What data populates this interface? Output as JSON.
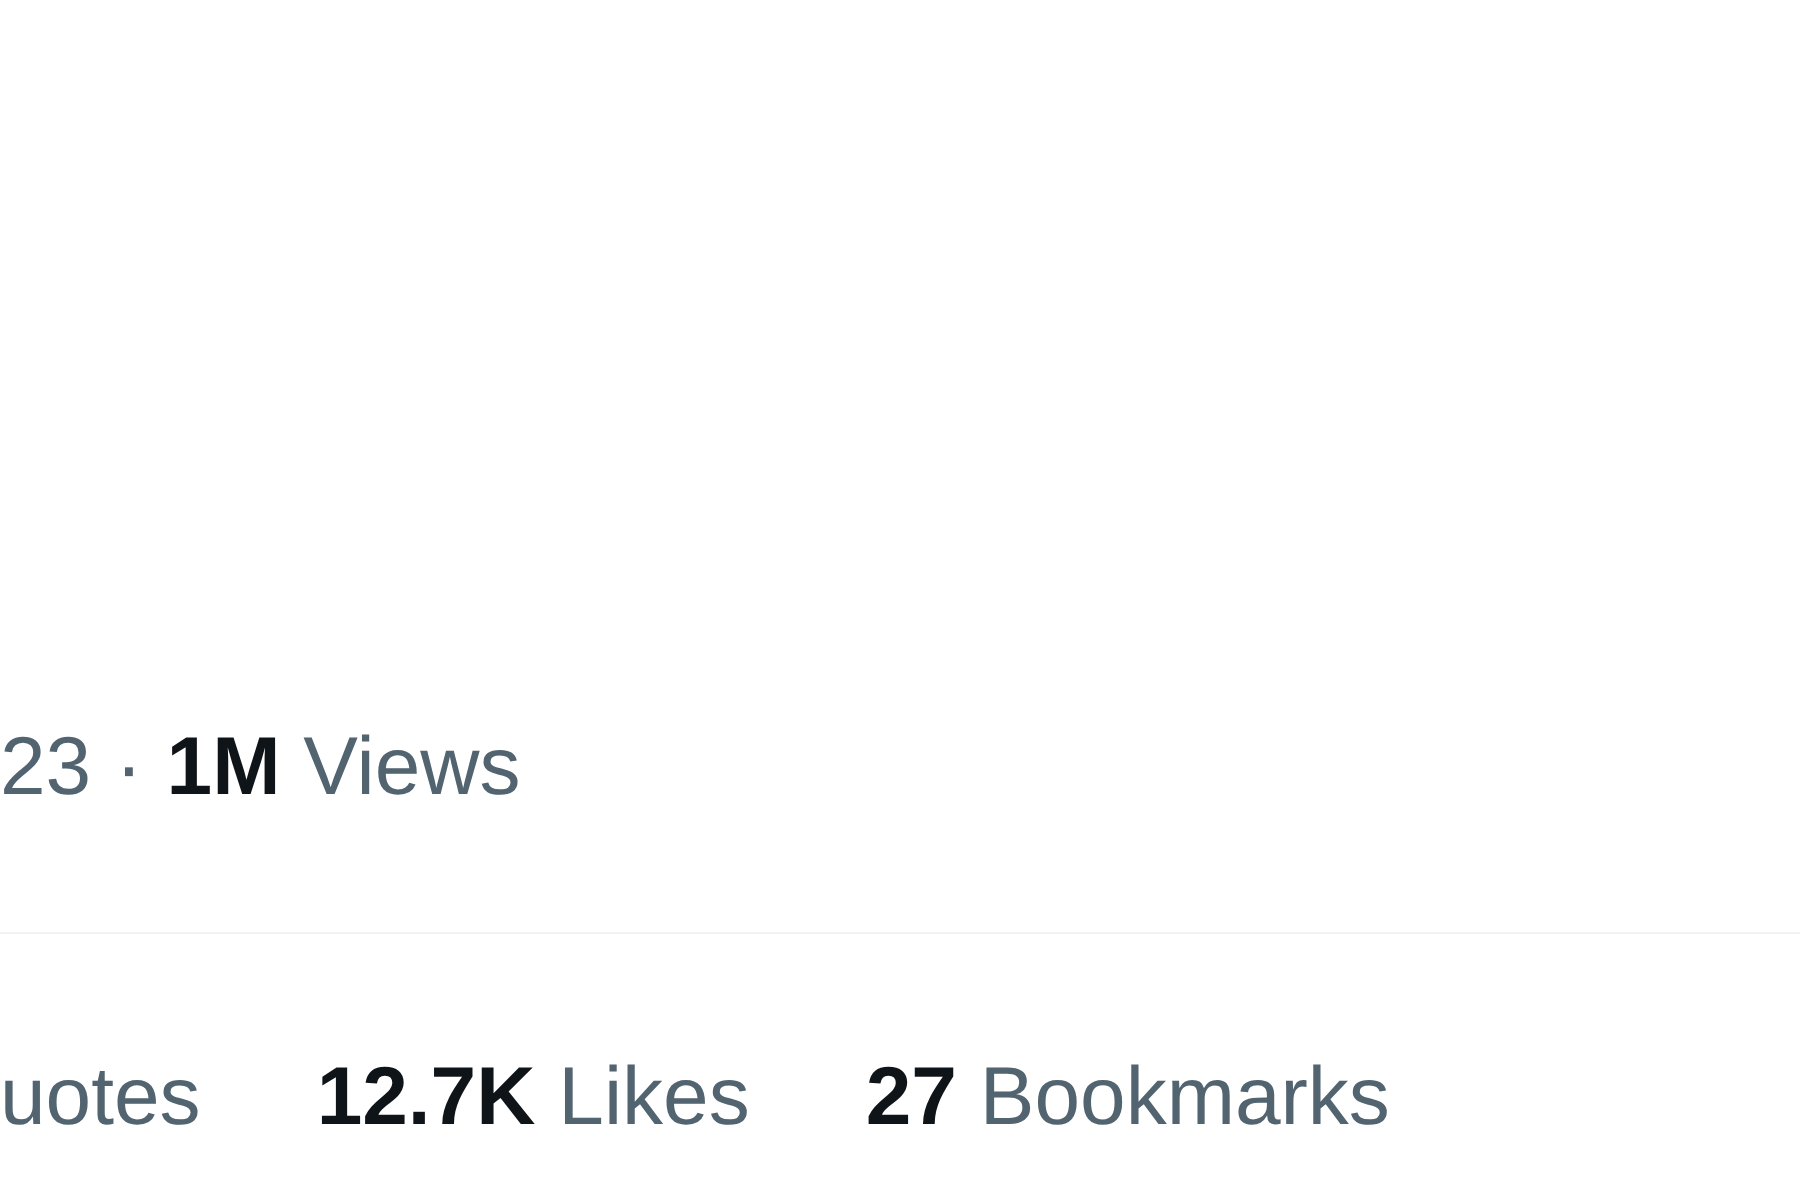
{
  "post_meta": {
    "date": "23",
    "separator": "·",
    "views": {
      "count": "1M",
      "label": "Views"
    }
  },
  "stats": [
    {
      "label": "uotes"
    },
    {
      "count": "12.7K",
      "label": "Likes"
    },
    {
      "count": "27",
      "label": "Bookmarks"
    }
  ]
}
